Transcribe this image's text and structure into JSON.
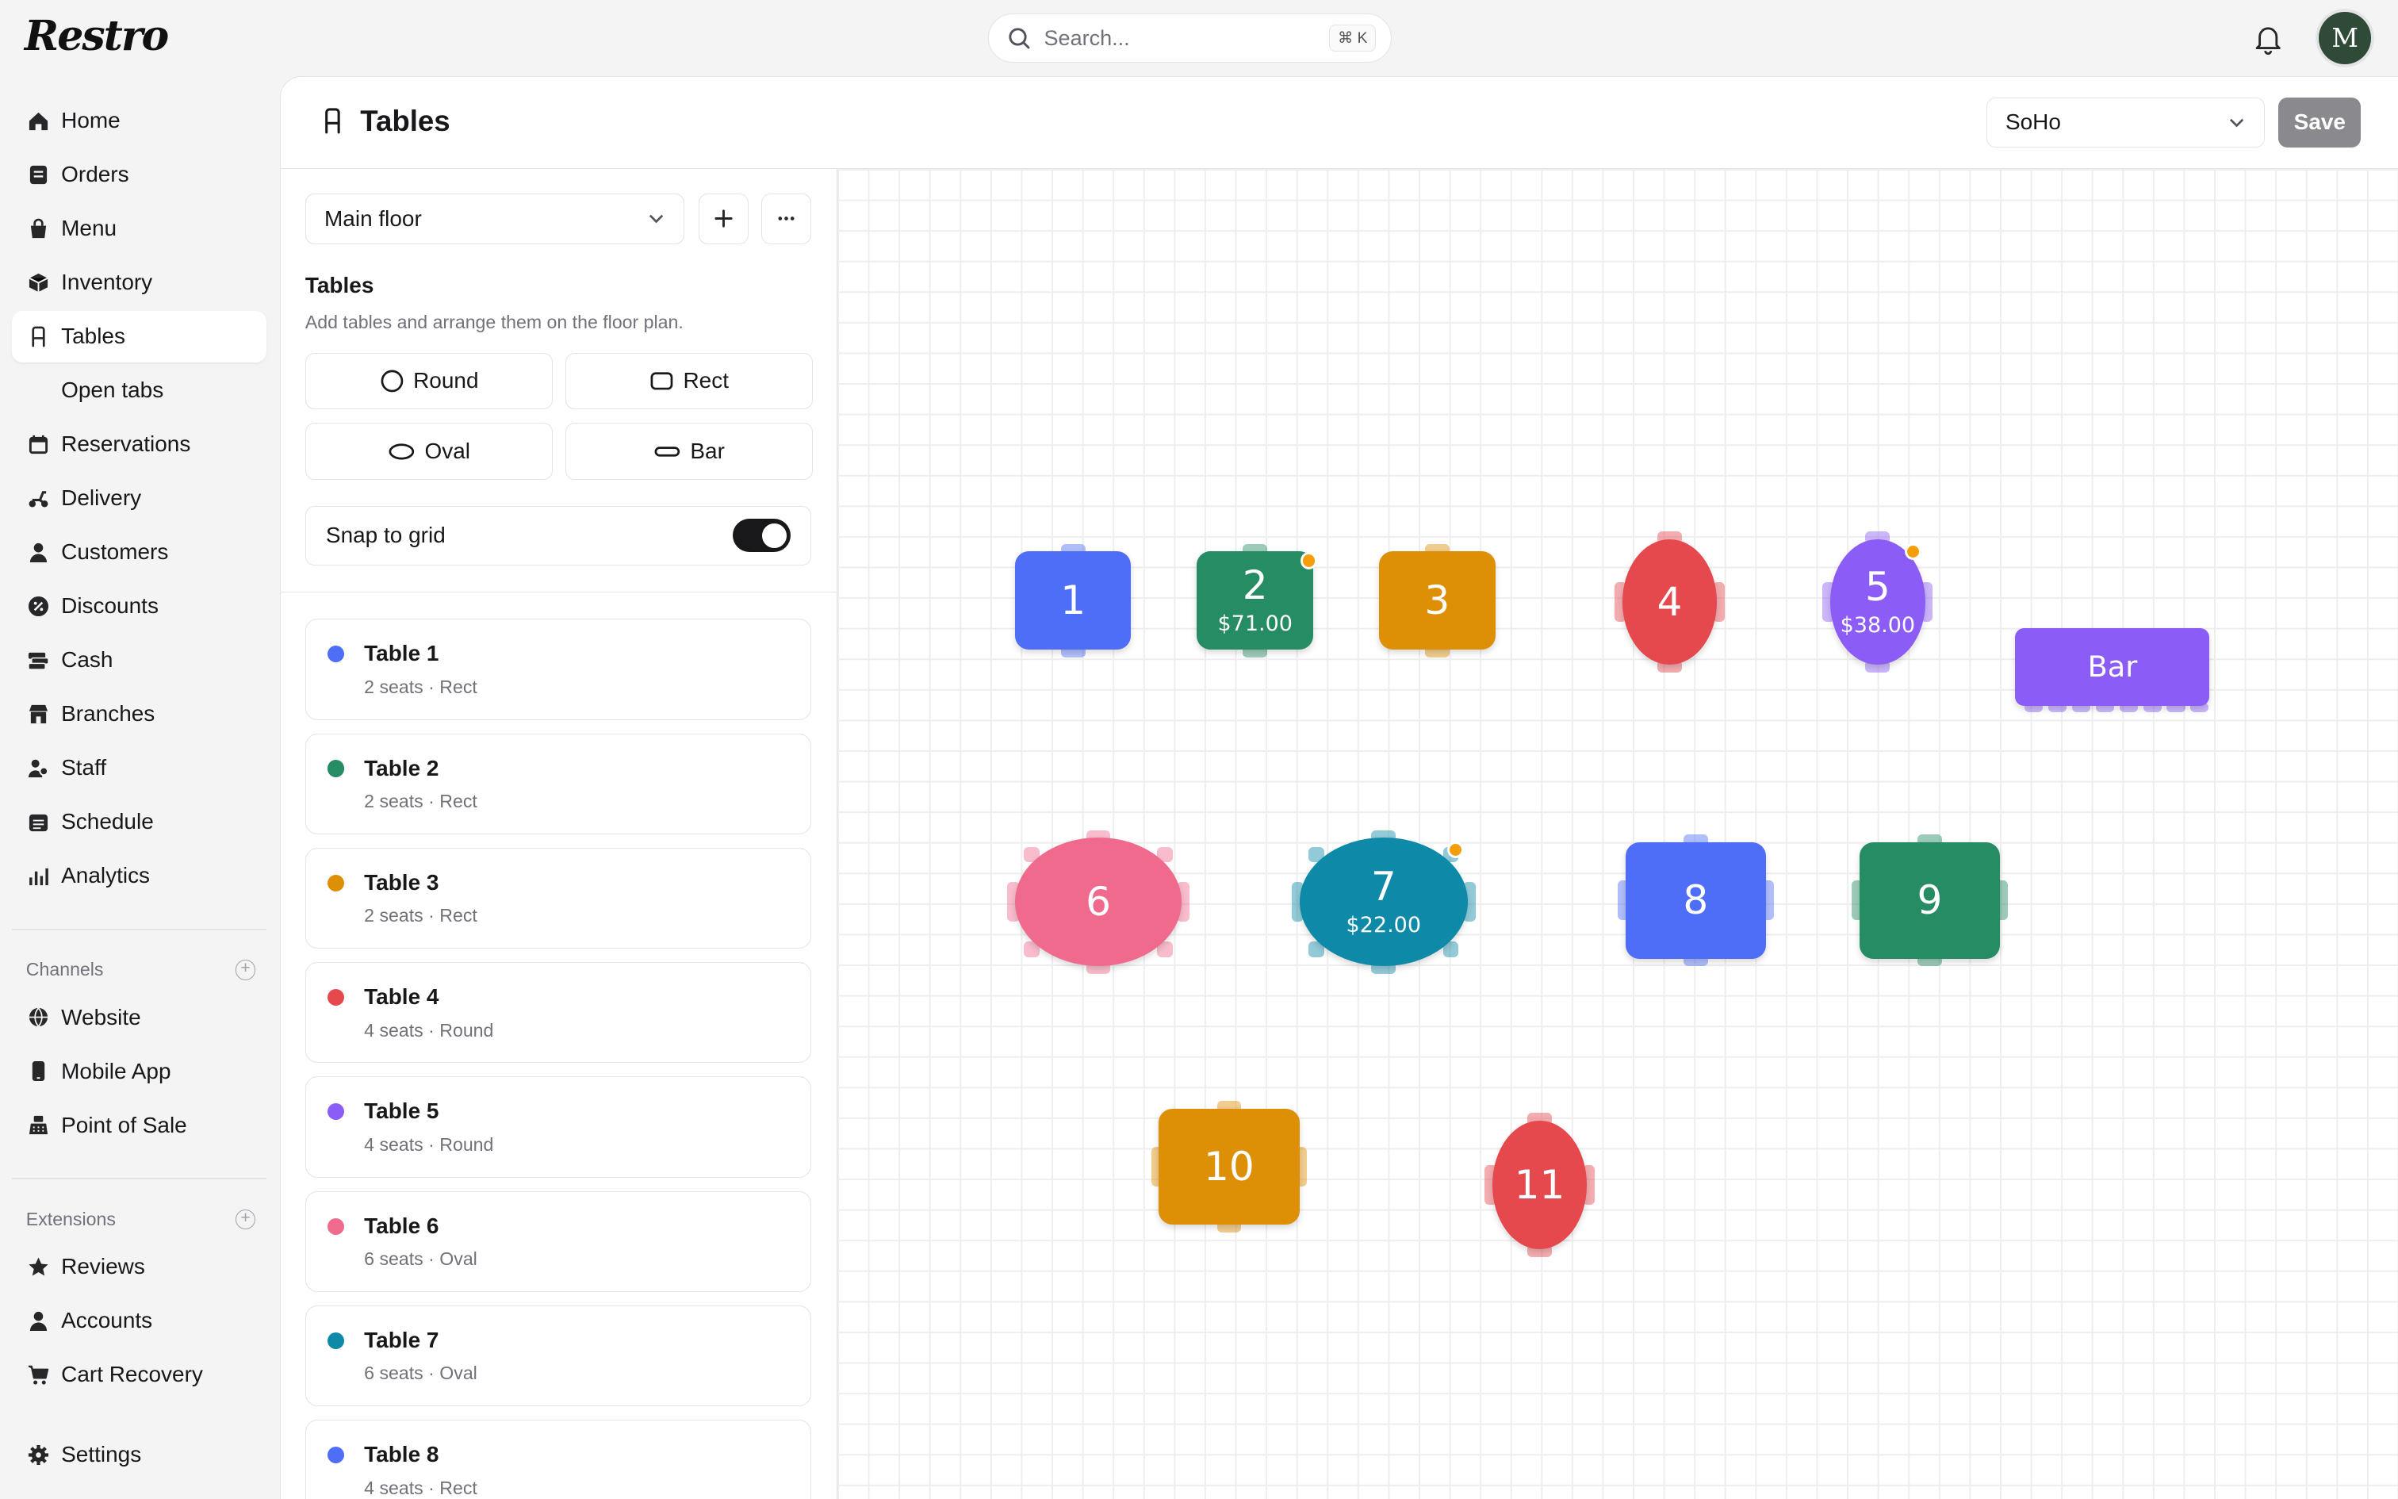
{
  "app": {
    "logo": "Restro"
  },
  "search": {
    "placeholder": "Search...",
    "shortcut": "⌘ K"
  },
  "user": {
    "avatar_initial": "M"
  },
  "sidebar": {
    "items": [
      {
        "label": "Home",
        "icon": "home-icon"
      },
      {
        "label": "Orders",
        "icon": "orders-icon"
      },
      {
        "label": "Menu",
        "icon": "menu-icon"
      },
      {
        "label": "Inventory",
        "icon": "inventory-icon"
      },
      {
        "label": "Tables",
        "icon": "chair-icon",
        "active": true
      },
      {
        "label": "Open tabs",
        "icon": ""
      },
      {
        "label": "Reservations",
        "icon": "calendar-icon"
      },
      {
        "label": "Delivery",
        "icon": "scooter-icon"
      },
      {
        "label": "Customers",
        "icon": "person-icon"
      },
      {
        "label": "Discounts",
        "icon": "discount-icon"
      },
      {
        "label": "Cash",
        "icon": "cash-icon"
      },
      {
        "label": "Branches",
        "icon": "store-icon"
      },
      {
        "label": "Staff",
        "icon": "staff-icon"
      },
      {
        "label": "Schedule",
        "icon": "schedule-icon"
      },
      {
        "label": "Analytics",
        "icon": "analytics-icon"
      }
    ],
    "channels_title": "Channels",
    "channels": [
      {
        "label": "Website",
        "icon": "globe-icon"
      },
      {
        "label": "Mobile App",
        "icon": "phone-icon"
      },
      {
        "label": "Point of Sale",
        "icon": "pos-icon"
      }
    ],
    "extensions_title": "Extensions",
    "extensions": [
      {
        "label": "Reviews",
        "icon": "star-icon"
      },
      {
        "label": "Accounts",
        "icon": "person-icon"
      },
      {
        "label": "Cart Recovery",
        "icon": "cart-icon"
      }
    ],
    "settings": {
      "label": "Settings",
      "icon": "gear-icon"
    }
  },
  "header": {
    "title": "Tables",
    "branch": "SoHo",
    "save_label": "Save"
  },
  "panel": {
    "floor": "Main floor",
    "section_title": "Tables",
    "section_subtitle": "Add tables and arrange them on the floor plan.",
    "shapes": [
      "Round",
      "Rect",
      "Oval",
      "Bar"
    ],
    "snap_label": "Snap to grid",
    "snap_on": true
  },
  "table_list": [
    {
      "name": "Table 1",
      "meta": "2 seats · Rect",
      "color": "#4f6ef7"
    },
    {
      "name": "Table 2",
      "meta": "2 seats · Rect",
      "color": "#258c63"
    },
    {
      "name": "Table 3",
      "meta": "2 seats · Rect",
      "color": "#dd8f06"
    },
    {
      "name": "Table 4",
      "meta": "4 seats · Round",
      "color": "#e5484d"
    },
    {
      "name": "Table 5",
      "meta": "4 seats · Round",
      "color": "#8b5cf6"
    },
    {
      "name": "Table 6",
      "meta": "6 seats · Oval",
      "color": "#f06a8e"
    },
    {
      "name": "Table 7",
      "meta": "6 seats · Oval",
      "color": "#0e8aa8"
    },
    {
      "name": "Table 8",
      "meta": "4 seats · Rect",
      "color": "#4f6ef7"
    }
  ],
  "floor_tables": [
    {
      "label": "1",
      "amount": "",
      "shape": "rect",
      "color": "#4f6ef7",
      "alert": false
    },
    {
      "label": "2",
      "amount": "$71.00",
      "shape": "rect",
      "color": "#258c63",
      "alert": true
    },
    {
      "label": "3",
      "amount": "",
      "shape": "rect",
      "color": "#dd8f06",
      "alert": false
    },
    {
      "label": "4",
      "amount": "",
      "shape": "round",
      "color": "#e5484d",
      "alert": false
    },
    {
      "label": "5",
      "amount": "$38.00",
      "shape": "round",
      "color": "#8b5cf6",
      "alert": true
    },
    {
      "label": "Bar",
      "amount": "",
      "shape": "bar",
      "color": "#8b5cf6",
      "alert": false
    },
    {
      "label": "6",
      "amount": "",
      "shape": "oval",
      "color": "#f06a8e",
      "alert": false
    },
    {
      "label": "7",
      "amount": "$22.00",
      "shape": "oval",
      "color": "#0e8aa8",
      "alert": true
    },
    {
      "label": "8",
      "amount": "",
      "shape": "rect",
      "color": "#4f6ef7",
      "alert": false
    },
    {
      "label": "9",
      "amount": "",
      "shape": "rect",
      "color": "#258c63",
      "alert": false
    },
    {
      "label": "10",
      "amount": "",
      "shape": "rect",
      "color": "#dd8f06",
      "alert": false
    },
    {
      "label": "11",
      "amount": "",
      "shape": "round",
      "color": "#e5484d",
      "alert": false
    }
  ]
}
